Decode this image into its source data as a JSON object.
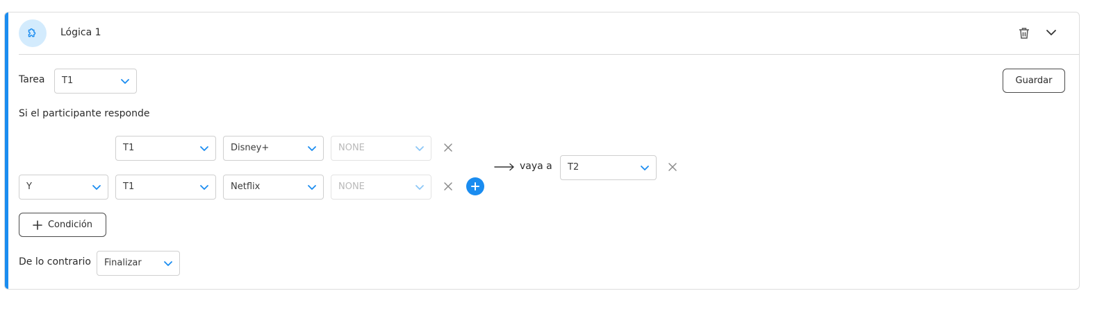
{
  "header": {
    "title": "Lógica 1",
    "icon": "puzzle-icon",
    "accent_color": "#1a8cf0"
  },
  "task": {
    "label": "Tarea",
    "value": "T1"
  },
  "save_label": "Guardar",
  "condition_intro": "Si el participante responde",
  "conditions": [
    {
      "connector": "",
      "task": "T1",
      "answer": "Disney+",
      "extra": "NONE"
    },
    {
      "connector": "Y",
      "task": "T1",
      "answer": "Netflix",
      "extra": "NONE"
    }
  ],
  "goto": {
    "label": "vaya a",
    "value": "T2"
  },
  "add_condition_label": "Condición",
  "otherwise": {
    "label": "De lo contrario",
    "value": "Finalizar"
  }
}
